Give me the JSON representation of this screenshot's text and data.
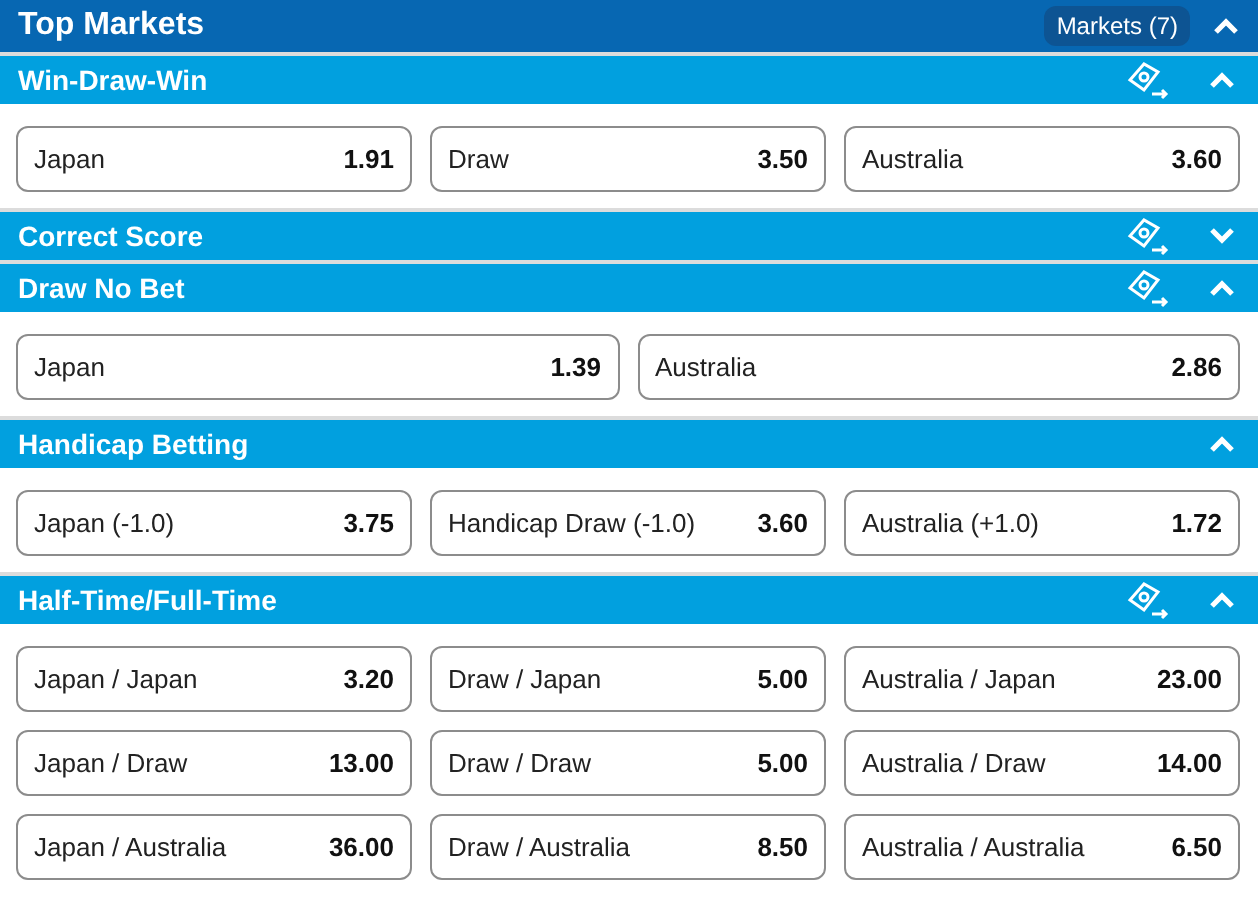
{
  "header": {
    "title": "Top Markets",
    "markets_badge": "Markets (7)",
    "expanded": true
  },
  "markets": [
    {
      "title": "Win-Draw-Win",
      "cash_out": true,
      "expanded": true,
      "selections": [
        {
          "name": "Japan",
          "odds": "1.91"
        },
        {
          "name": "Draw",
          "odds": "3.50"
        },
        {
          "name": "Australia",
          "odds": "3.60"
        }
      ]
    },
    {
      "title": "Correct Score",
      "cash_out": true,
      "expanded": false
    },
    {
      "title": "Draw No Bet",
      "cash_out": true,
      "expanded": true,
      "selections": [
        {
          "name": "Japan",
          "odds": "1.39"
        },
        {
          "name": "Australia",
          "odds": "2.86"
        }
      ]
    },
    {
      "title": "Handicap Betting",
      "cash_out": false,
      "expanded": true,
      "selections": [
        {
          "name": "Japan (-1.0)",
          "odds": "3.75"
        },
        {
          "name": "Handicap Draw (-1.0)",
          "odds": "3.60"
        },
        {
          "name": "Australia (+1.0)",
          "odds": "1.72"
        }
      ]
    },
    {
      "title": "Half-Time/Full-Time",
      "cash_out": true,
      "expanded": true,
      "selections": [
        {
          "name": "Japan / Japan",
          "odds": "3.20"
        },
        {
          "name": "Draw / Japan",
          "odds": "5.00"
        },
        {
          "name": "Australia / Japan",
          "odds": "23.00"
        },
        {
          "name": "Japan / Draw",
          "odds": "13.00"
        },
        {
          "name": "Draw / Draw",
          "odds": "5.00"
        },
        {
          "name": "Australia / Draw",
          "odds": "14.00"
        },
        {
          "name": "Japan / Australia",
          "odds": "36.00"
        },
        {
          "name": "Draw / Australia",
          "odds": "8.50"
        },
        {
          "name": "Australia / Australia",
          "odds": "6.50"
        }
      ]
    }
  ]
}
